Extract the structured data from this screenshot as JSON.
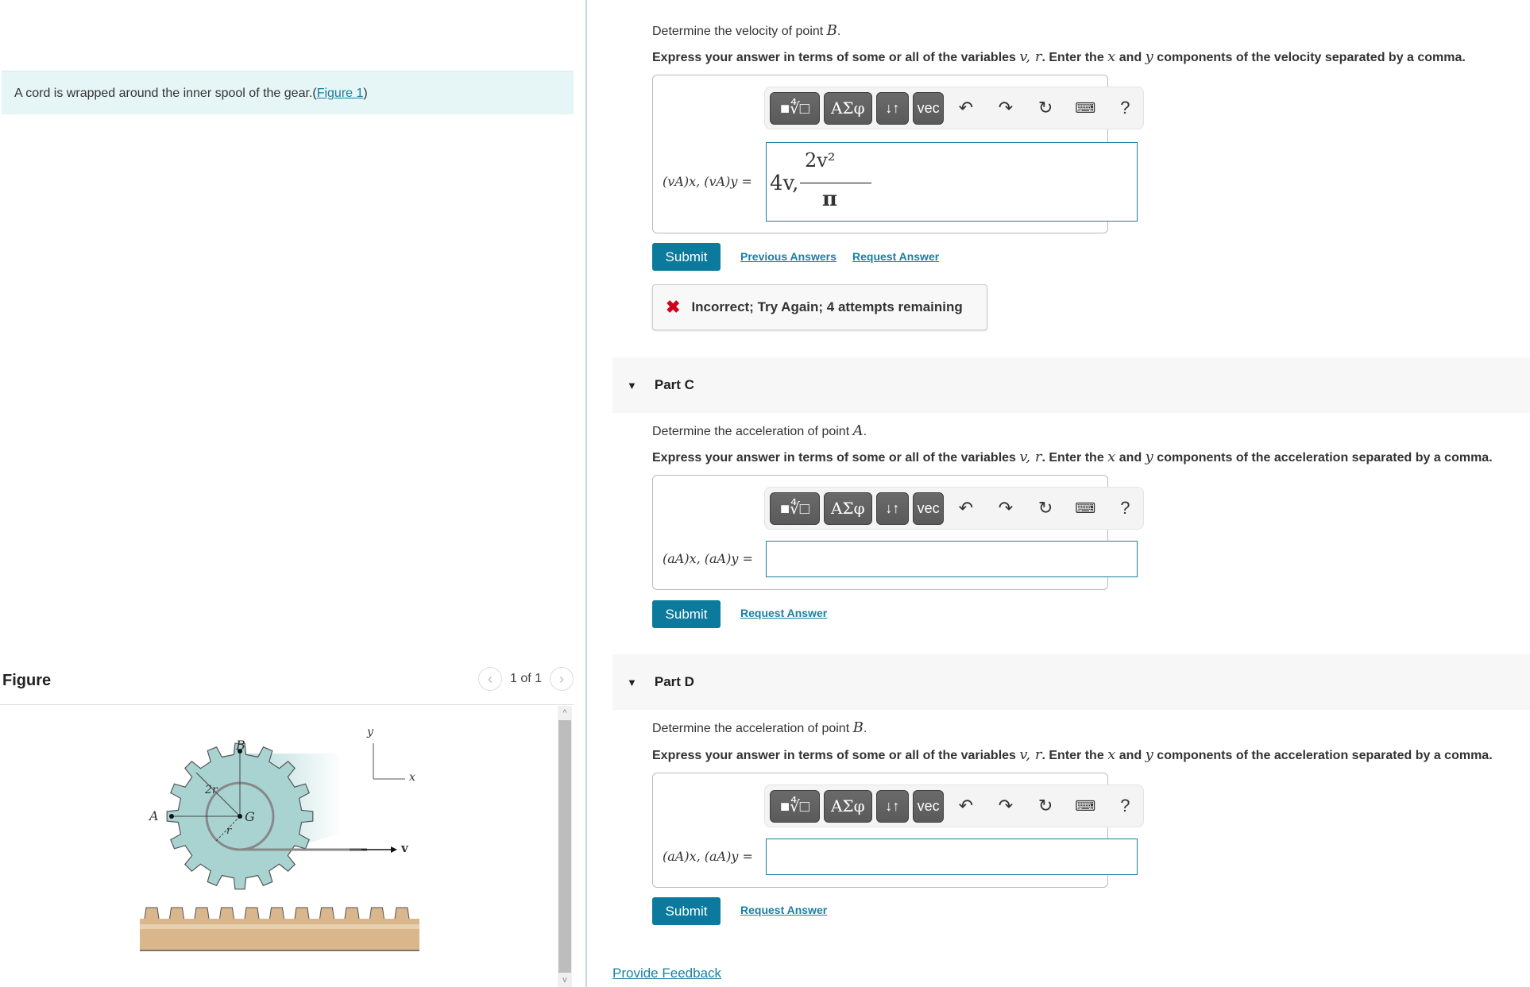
{
  "intro": {
    "text": "A cord is wrapped around the inner spool of the gear.",
    "link_label": "Figure 1",
    "open_paren": "(",
    "close_paren": ")"
  },
  "figure": {
    "title": "Figure",
    "pager_text": "1 of 1",
    "prev_icon": "chevron-left-icon",
    "next_icon": "chevron-right-icon",
    "labels": {
      "B": "B",
      "A": "A",
      "G": "G",
      "r": "r",
      "two_r": "2r",
      "y": "y",
      "x": "x",
      "v": "v"
    }
  },
  "toolbar": {
    "templates": "■∜□",
    "greek": "ΑΣφ",
    "arrows": "↓↑",
    "vec": "vec",
    "undo": "↶",
    "redo": "↷",
    "reset": "↻",
    "keyboard": "⌨",
    "help": "?"
  },
  "partB": {
    "question_pre": "Determine the velocity of point ",
    "question_var": "B",
    "question_post": ".",
    "instr_pre": "Express your answer in terms of some or all of the variables ",
    "instr_vars": "v, r",
    "instr_mid": ". Enter the ",
    "instr_x": "x",
    "instr_and": " and ",
    "instr_y": "y",
    "instr_post": " components of the velocity separated by a comma.",
    "lhs": "(vA)x, (vA)y =",
    "answer": {
      "first": "4v,",
      "numerator": "2v²",
      "denominator": "π"
    },
    "submit": "Submit",
    "previous_answers": "Previous Answers",
    "request_answer": "Request Answer",
    "feedback": "Incorrect; Try Again; 4 attempts remaining"
  },
  "partC": {
    "label": "Part C",
    "question_pre": "Determine the acceleration of point ",
    "question_var": "A",
    "question_post": ".",
    "instr_pre": "Express your answer in terms of some or all of the variables ",
    "instr_vars": "v, r",
    "instr_mid": ". Enter the ",
    "instr_x": "x",
    "instr_and": " and ",
    "instr_y": "y",
    "instr_post": " components of the acceleration separated by a comma.",
    "lhs": "(aA)x, (aA)y =",
    "answer": "",
    "submit": "Submit",
    "request_answer": "Request Answer"
  },
  "partD": {
    "label": "Part D",
    "question_pre": "Determine the acceleration of point ",
    "question_var": "B",
    "question_post": ".",
    "instr_pre": "Express your answer in terms of some or all of the variables ",
    "instr_vars": "v, r",
    "instr_mid": ". Enter the ",
    "instr_x": "x",
    "instr_and": " and ",
    "instr_y": "y",
    "instr_post": " components of the acceleration separated by a comma.",
    "lhs": "(aA)x, (aA)y =",
    "answer": "",
    "submit": "Submit",
    "request_answer": "Request Answer"
  },
  "provide_feedback": "Provide Feedback",
  "colors": {
    "accent": "#0b7a9c",
    "link": "#1a7fa0",
    "error": "#d0021b",
    "intro_bg": "#e6f5f6"
  }
}
